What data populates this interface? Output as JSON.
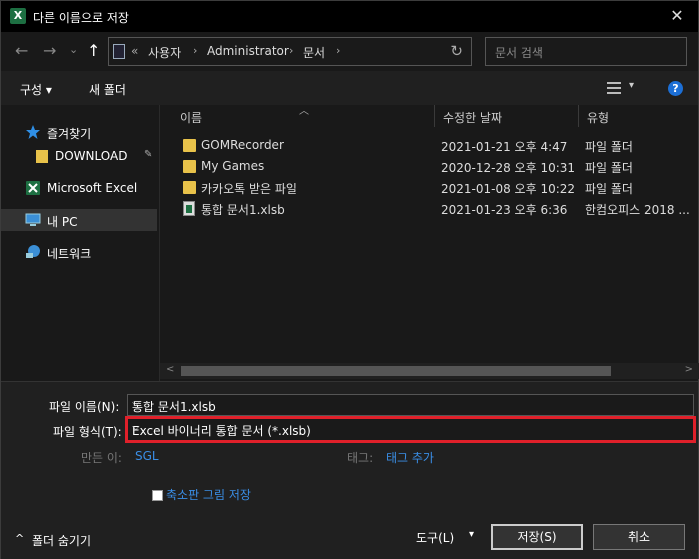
{
  "window": {
    "title": "다른 이름으로 저장",
    "app_icon": "X",
    "close_glyph": "✕"
  },
  "nav": {
    "back": "←",
    "forward": "→",
    "recent": "⌄",
    "up": "↑",
    "breadcrumb": [
      "«",
      "사용자",
      "Administrator",
      "문서"
    ],
    "sep": "›",
    "refresh": "↻",
    "search_placeholder": "문서 검색"
  },
  "toolbar": {
    "organize": "구성 ▾",
    "new_folder": "새 폴더",
    "view_dropdown": "▾",
    "help": "?"
  },
  "sidebar": {
    "items": [
      {
        "label": "즐겨찾기",
        "icon": "star-icon"
      },
      {
        "label": "DOWNLOAD",
        "icon": "folder-icon",
        "pin": "✎"
      },
      {
        "label": "Microsoft Excel",
        "icon": "excel-icon"
      },
      {
        "label": "내 PC",
        "icon": "computer-icon"
      },
      {
        "label": "네트워크",
        "icon": "network-icon"
      }
    ]
  },
  "files": {
    "sort_arrow": "︿",
    "columns": [
      "이름",
      "수정한 날짜",
      "유형"
    ],
    "rows": [
      {
        "name": "GOMRecorder",
        "date": "2021-01-21 오후 4:47",
        "type": "파일 폴더",
        "kind": "folder"
      },
      {
        "name": "My Games",
        "date": "2020-12-28 오후 10:31",
        "type": "파일 폴더",
        "kind": "folder"
      },
      {
        "name": "카카오톡 받은 파일",
        "date": "2021-01-08 오후 10:22",
        "type": "파일 폴더",
        "kind": "folder"
      },
      {
        "name": "통합 문서1.xlsb",
        "date": "2021-01-23 오후 6:36",
        "type": "한컴오피스 2018 ...",
        "kind": "xlsb"
      }
    ],
    "scroll_left": "<",
    "scroll_right": ">"
  },
  "form": {
    "filename_label": "파일 이름(N):",
    "filename_value": "통합 문서1.xlsb",
    "filetype_label": "파일 형식(T):",
    "filetype_value": "Excel 바이너리 통합 문서 (*.xlsb)",
    "dropdown_glyph": "⌵",
    "author_label": "만든 이:",
    "author_value": "SGL",
    "tags_label": "태그:",
    "tags_value": "태그 추가",
    "thumbnail_label": "축소판 그림 저장",
    "hide_folders": "폴더 숨기기",
    "hide_chevron": "^",
    "tools": "도구(L)",
    "tools_chevron": "▾",
    "save": "저장(S)",
    "cancel": "취소"
  },
  "colors": {
    "accent": "#3a8ee6",
    "highlight": "#e0202a",
    "folder": "#e8c24a",
    "excel": "#1d6f42"
  }
}
